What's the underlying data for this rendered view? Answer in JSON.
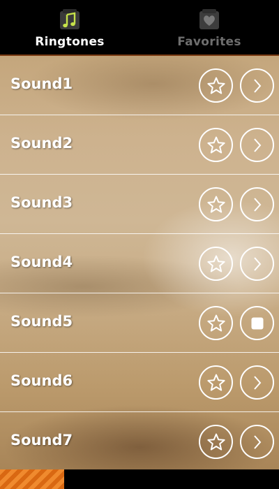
{
  "tabs": [
    {
      "label": "Ringtones",
      "icon": "music-note-icon",
      "active": true
    },
    {
      "label": "Favorites",
      "icon": "heart-icon",
      "active": false
    }
  ],
  "sounds": [
    {
      "title": "Sound1",
      "favorite_icon": "star-icon",
      "action_icon": "chevron-right-icon"
    },
    {
      "title": "Sound2",
      "favorite_icon": "star-icon",
      "action_icon": "chevron-right-icon"
    },
    {
      "title": "Sound3",
      "favorite_icon": "star-icon",
      "action_icon": "chevron-right-icon"
    },
    {
      "title": "Sound4",
      "favorite_icon": "star-icon",
      "action_icon": "chevron-right-icon"
    },
    {
      "title": "Sound5",
      "favorite_icon": "star-icon",
      "action_icon": "stop-icon"
    },
    {
      "title": "Sound6",
      "favorite_icon": "star-icon",
      "action_icon": "chevron-right-icon"
    },
    {
      "title": "Sound7",
      "favorite_icon": "star-icon",
      "action_icon": "chevron-right-icon"
    }
  ],
  "playback": {
    "progress_fraction": 0.23
  },
  "colors": {
    "accent_orange": "#f08a2e",
    "active_tab_text": "#ffffff",
    "inactive_tab_text": "#6e6e6e",
    "music_note_green": "#c6e24a"
  }
}
